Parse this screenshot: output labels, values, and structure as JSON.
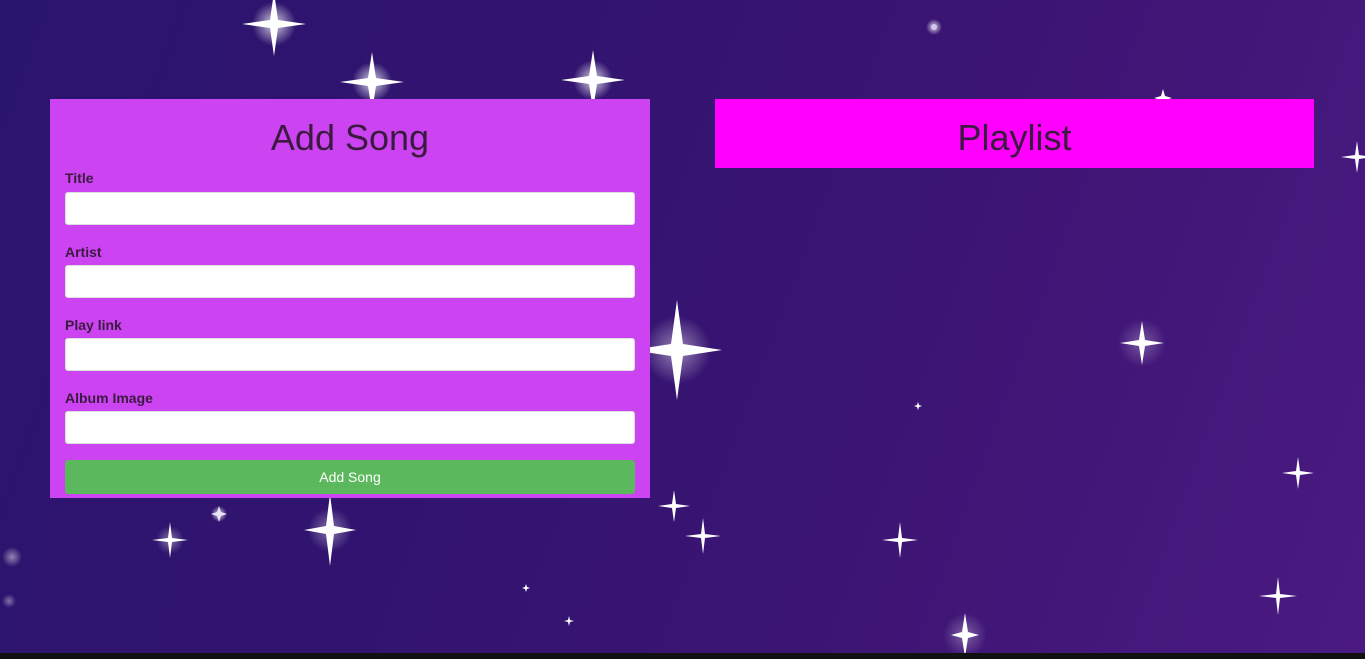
{
  "add_song": {
    "heading": "Add Song",
    "fields": [
      {
        "label": "Title",
        "value": ""
      },
      {
        "label": "Artist",
        "value": ""
      },
      {
        "label": "Play link",
        "value": ""
      },
      {
        "label": "Album Image",
        "value": ""
      }
    ],
    "submit_label": "Add Song"
  },
  "playlist": {
    "heading": "Playlist"
  },
  "colors": {
    "add_panel": "#cc44f2",
    "playlist_panel": "#ff00ff",
    "submit_button": "#5cb85c",
    "background": "#331470"
  },
  "background_decor": "sparkle-star-icon"
}
